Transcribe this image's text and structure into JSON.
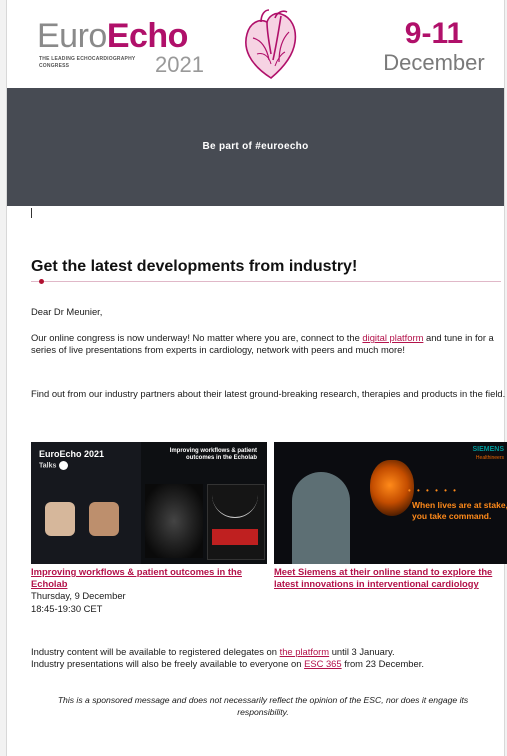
{
  "header": {
    "logo_part1": "Euro",
    "logo_part2": "Echo",
    "logo_tagline": "The leading echocardiography congress",
    "logo_year": "2021",
    "dates_days": "9-11",
    "dates_month": "December"
  },
  "banner": {
    "text": "Be part of #euroecho"
  },
  "content": {
    "title": "Get the latest developments from industry!",
    "greeting": "Dear Dr Meunier,",
    "intro_before_link": "Our online congress is now underway! No matter where you are, connect to the ",
    "intro_link": "digital platform",
    "intro_after_link": " and tune in for a series of live presentations from experts in cardiology, network with peers and much more!",
    "partners_text": "Find out from our industry partners about their latest ground-breaking research, therapies and products in the field.",
    "tiles": [
      {
        "image_title": "EuroEcho 2021",
        "image_subtitle": "Talks",
        "image_heading": "Improving workflows & patient outcomes in the Echolab",
        "link": "Improving workflows & patient outcomes in the Echolab",
        "date": "Thursday, 9 December",
        "time": "18:45-19:30 CET"
      },
      {
        "image_logo": "SIEMENS",
        "image_logo_sub": "Healthineers",
        "image_dots": "• • • • • •",
        "image_tagline": "When lives are at stake, you take command.",
        "link": "Meet Siemens at their online stand to explore the latest innovations in interventional cardiology"
      }
    ],
    "availability_before_link": "Industry content will be available to registered delegates on ",
    "availability_link": "the platform",
    "availability_after_link": " until 3 January.",
    "free_before_link": "Industry presentations will also be freely available to everyone on ",
    "free_link": "ESC 365",
    "free_after_link": " from 23 December.",
    "disclaimer": "This is a sponsored message and does not necessarily reflect the opinion of the ESC, nor does it engage its responsibility."
  },
  "colors": {
    "brand": "#b0106a",
    "banner_bg": "#474b53",
    "link": "#b3124a"
  },
  "icons": {
    "heart": "anatomical-heart-icon",
    "play": "play-icon"
  }
}
